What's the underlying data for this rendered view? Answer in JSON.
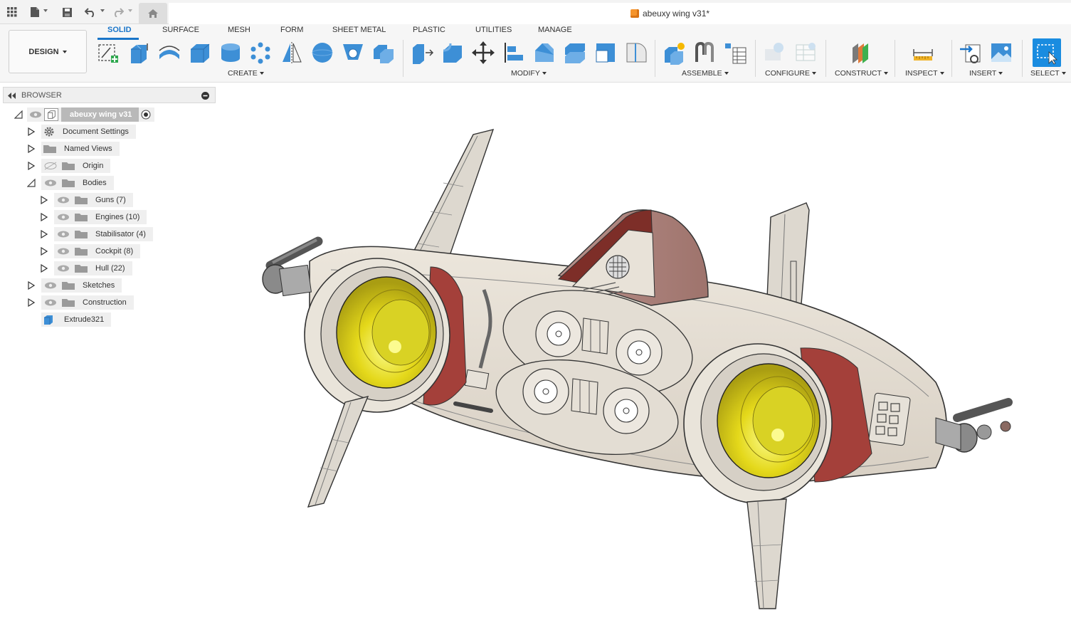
{
  "app": {
    "document_title": "abeuxy wing v31*"
  },
  "ribbon": {
    "workspace_label": "DESIGN",
    "tabs": [
      {
        "label": "SOLID",
        "active": true
      },
      {
        "label": "SURFACE",
        "active": false
      },
      {
        "label": "MESH",
        "active": false
      },
      {
        "label": "FORM",
        "active": false
      },
      {
        "label": "SHEET METAL",
        "active": false
      },
      {
        "label": "PLASTIC",
        "active": false
      },
      {
        "label": "UTILITIES",
        "active": false
      },
      {
        "label": "MANAGE",
        "active": false
      }
    ],
    "groups": {
      "create": "CREATE",
      "modify": "MODIFY",
      "assemble": "ASSEMBLE",
      "configure": "CONFIGURE",
      "construct": "CONSTRUCT",
      "inspect": "INSPECT",
      "insert": "INSERT",
      "select": "SELECT"
    },
    "accent_color": "#1a75c9"
  },
  "browser": {
    "title": "BROWSER",
    "root": "abeuxy wing v31",
    "items": {
      "document_settings": "Document Settings",
      "named_views": "Named Views",
      "origin": "Origin",
      "bodies": "Bodies",
      "guns": "Guns (7)",
      "engines": "Engines (10)",
      "stabilisator": "Stabilisator (4)",
      "cockpit": "Cockpit (8)",
      "hull": "Hull (22)",
      "sketches": "Sketches",
      "construction": "Construction",
      "extrude": "Extrude321"
    }
  }
}
